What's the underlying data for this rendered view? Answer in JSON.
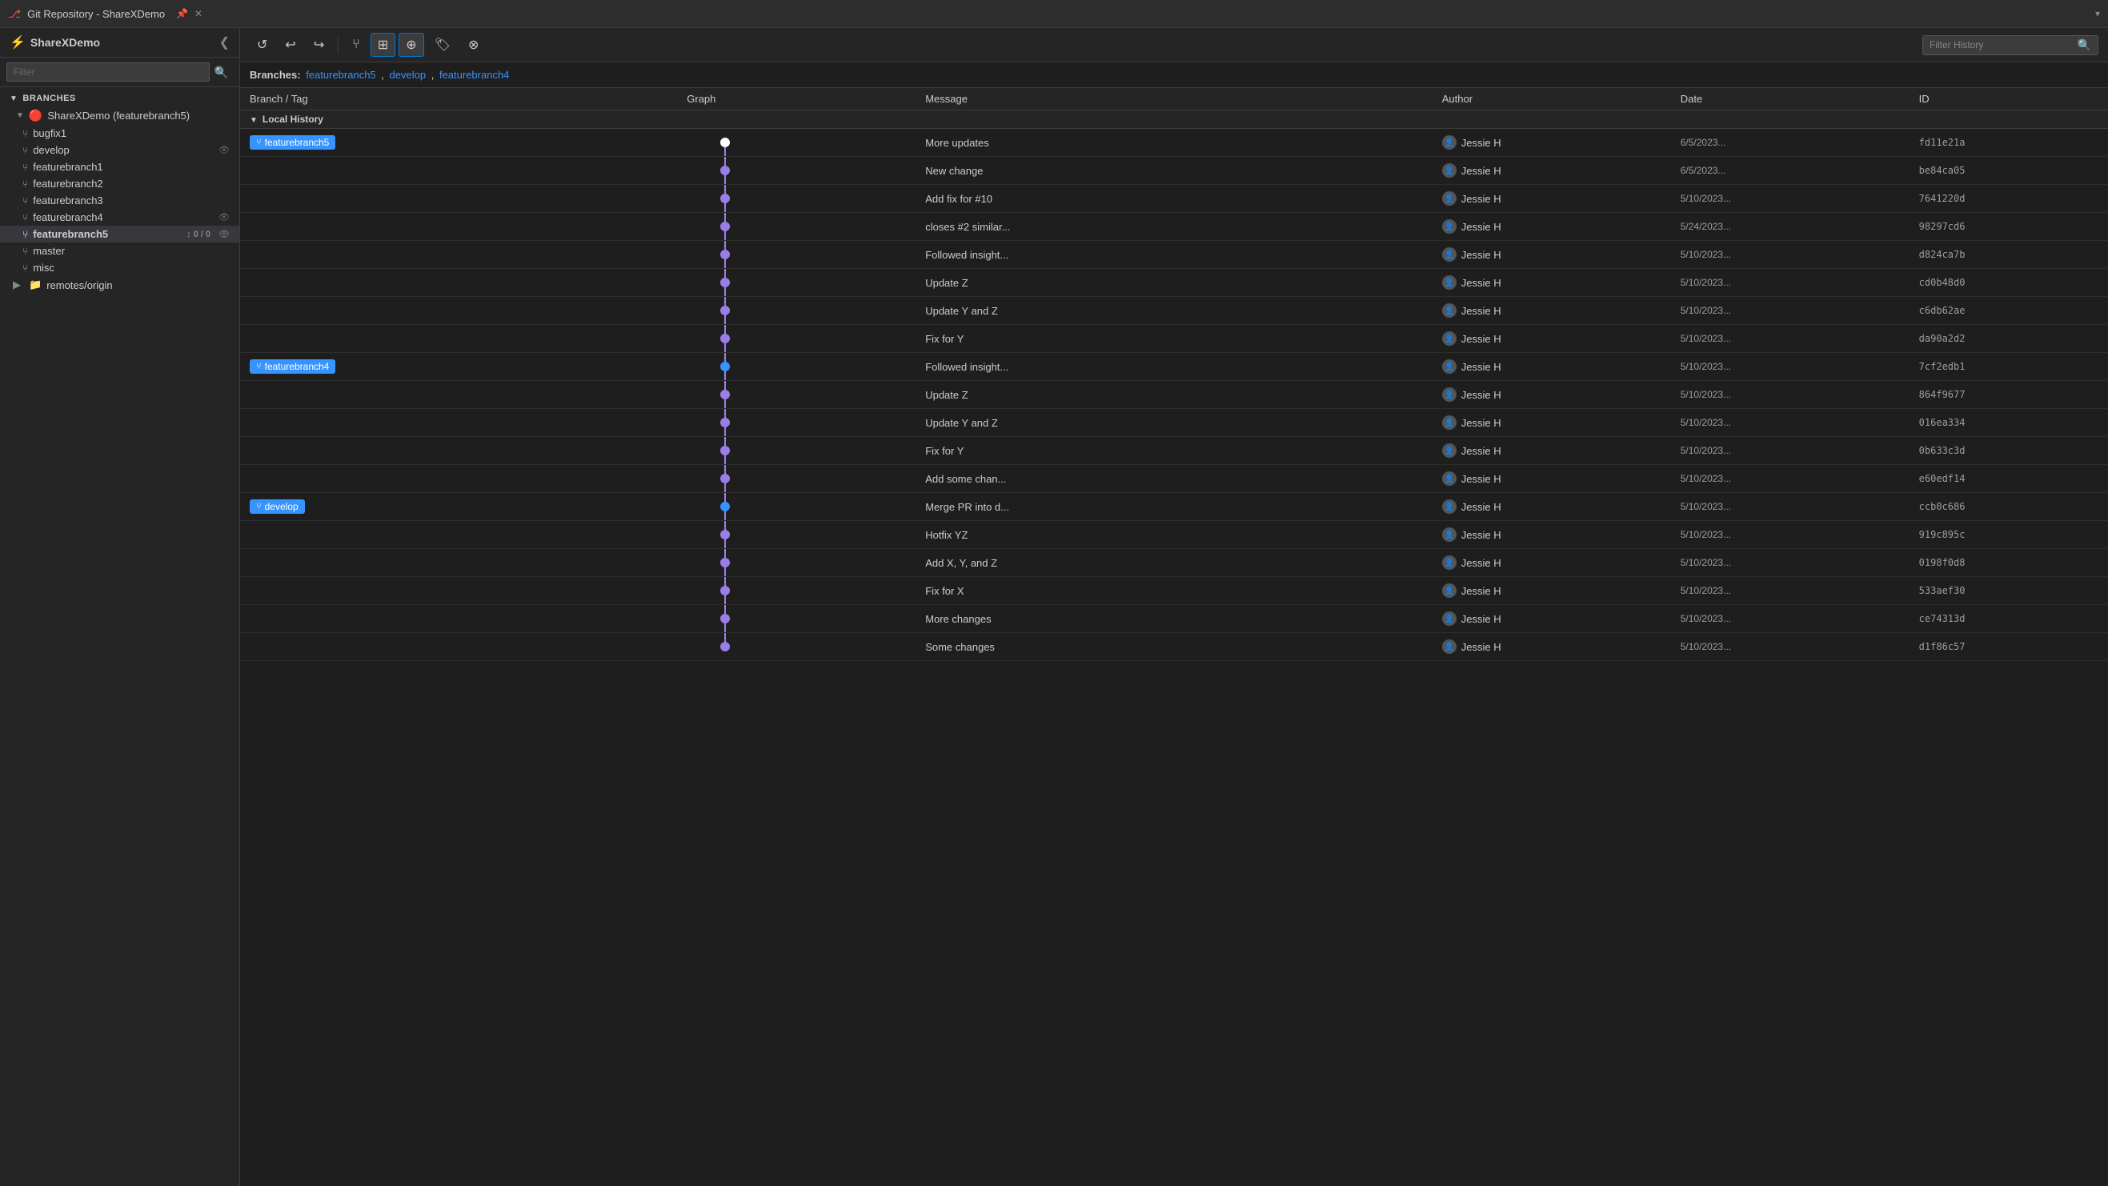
{
  "titleBar": {
    "title": "Git Repository - ShareXDemo",
    "pinLabel": "📌",
    "closeLabel": "✕"
  },
  "sidebar": {
    "repoName": "ShareXDemo",
    "filterPlaceholder": "Filter",
    "branchesSectionLabel": "Branches",
    "items": [
      {
        "id": "sharexdemo",
        "label": "ShareXDemo (featurebranch5)",
        "indent": 0,
        "isRoot": true,
        "active": false
      },
      {
        "id": "bugfix1",
        "label": "bugfix1",
        "indent": 1
      },
      {
        "id": "develop",
        "label": "develop",
        "indent": 1,
        "hasEye": true
      },
      {
        "id": "featurebranch1",
        "label": "featurebranch1",
        "indent": 1
      },
      {
        "id": "featurebranch2",
        "label": "featurebranch2",
        "indent": 1
      },
      {
        "id": "featurebranch3",
        "label": "featurebranch3",
        "indent": 1
      },
      {
        "id": "featurebranch4",
        "label": "featurebranch4",
        "indent": 1,
        "hasEye": true
      },
      {
        "id": "featurebranch5",
        "label": "featurebranch5",
        "indent": 1,
        "active": true,
        "syncBadge": "↕ 0 / 0",
        "hasEye": true
      },
      {
        "id": "master",
        "label": "master",
        "indent": 1
      },
      {
        "id": "misc",
        "label": "misc",
        "indent": 1
      },
      {
        "id": "remotes",
        "label": "remotes/origin",
        "indent": 0,
        "isRemote": true
      }
    ]
  },
  "toolbar": {
    "refreshLabel": "↺",
    "undoLabel": "↩",
    "redoLabel": "↪",
    "branchLabel": "⎇",
    "commitGraphLabel": "⦿",
    "commitAllLabel": "⊕",
    "tagLabel": "🏷",
    "moreLabel": "⊗",
    "filterHistoryPlaceholder": "Filter History",
    "searchIcon": "🔍"
  },
  "branchesBar": {
    "label": "Branches:",
    "branches": [
      "featurebranch5",
      "develop",
      "featurebranch4"
    ]
  },
  "historyTable": {
    "headers": {
      "branchTag": "Branch / Tag",
      "graph": "Graph",
      "message": "Message",
      "author": "Author",
      "date": "Date",
      "id": "ID"
    },
    "sections": [
      {
        "sectionLabel": "Local History",
        "commits": [
          {
            "branchTag": "featurebranch5",
            "message": "More updates",
            "author": "Jessie H",
            "date": "6/5/2023...",
            "id": "fd11e21a",
            "graphType": "head",
            "color": "#9b7de8"
          },
          {
            "branchTag": "",
            "message": "New change",
            "author": "Jessie H",
            "date": "6/5/2023...",
            "id": "be84ca05",
            "graphType": "mid",
            "color": "#9b7de8"
          },
          {
            "branchTag": "",
            "message": "Add fix for #10",
            "author": "Jessie H",
            "date": "5/10/2023...",
            "id": "7641220d",
            "graphType": "mid",
            "color": "#9b7de8"
          },
          {
            "branchTag": "",
            "message": "closes #2 similar...",
            "author": "Jessie H",
            "date": "5/24/2023...",
            "id": "98297cd6",
            "graphType": "mid",
            "color": "#9b7de8"
          },
          {
            "branchTag": "",
            "message": "Followed insight...",
            "author": "Jessie H",
            "date": "5/10/2023...",
            "id": "d824ca7b",
            "graphType": "mid",
            "color": "#9b7de8"
          },
          {
            "branchTag": "",
            "message": "Update Z",
            "author": "Jessie H",
            "date": "5/10/2023...",
            "id": "cd0b48d0",
            "graphType": "mid",
            "color": "#9b7de8"
          },
          {
            "branchTag": "",
            "message": "Update Y and Z",
            "author": "Jessie H",
            "date": "5/10/2023...",
            "id": "c6db62ae",
            "graphType": "mid",
            "color": "#9b7de8"
          },
          {
            "branchTag": "",
            "message": "Fix for Y",
            "author": "Jessie H",
            "date": "5/10/2023...",
            "id": "da90a2d2",
            "graphType": "mid",
            "color": "#9b7de8"
          },
          {
            "branchTag": "featurebranch4",
            "message": "Followed insight...",
            "author": "Jessie H",
            "date": "5/10/2023...",
            "id": "7cf2edb1",
            "graphType": "branch-head",
            "color": "#3794ff"
          },
          {
            "branchTag": "",
            "message": "Update Z",
            "author": "Jessie H",
            "date": "5/10/2023...",
            "id": "864f9677",
            "graphType": "mid",
            "color": "#9b7de8"
          },
          {
            "branchTag": "",
            "message": "Update Y and Z",
            "author": "Jessie H",
            "date": "5/10/2023...",
            "id": "016ea334",
            "graphType": "mid",
            "color": "#9b7de8"
          },
          {
            "branchTag": "",
            "message": "Fix for Y",
            "author": "Jessie H",
            "date": "5/10/2023...",
            "id": "0b633c3d",
            "graphType": "mid",
            "color": "#9b7de8"
          },
          {
            "branchTag": "",
            "message": "Add some chan...",
            "author": "Jessie H",
            "date": "5/10/2023...",
            "id": "e60edf14",
            "graphType": "mid",
            "color": "#9b7de8"
          },
          {
            "branchTag": "develop",
            "message": "Merge PR into d...",
            "author": "Jessie H",
            "date": "5/10/2023...",
            "id": "ccb0c686",
            "graphType": "branch-head2",
            "color": "#3794ff"
          },
          {
            "branchTag": "",
            "message": "Hotfix YZ",
            "author": "Jessie H",
            "date": "5/10/2023...",
            "id": "919c895c",
            "graphType": "mid",
            "color": "#9b7de8"
          },
          {
            "branchTag": "",
            "message": "Add X, Y, and Z",
            "author": "Jessie H",
            "date": "5/10/2023...",
            "id": "0198f0d8",
            "graphType": "mid",
            "color": "#9b7de8"
          },
          {
            "branchTag": "",
            "message": "Fix for X",
            "author": "Jessie H",
            "date": "5/10/2023...",
            "id": "533aef30",
            "graphType": "mid",
            "color": "#9b7de8"
          },
          {
            "branchTag": "",
            "message": "More changes",
            "author": "Jessie H",
            "date": "5/10/2023...",
            "id": "ce74313d",
            "graphType": "mid",
            "color": "#9b7de8"
          },
          {
            "branchTag": "",
            "message": "Some changes",
            "author": "Jessie H",
            "date": "5/10/2023...",
            "id": "d1f86c57",
            "graphType": "mid-bottom",
            "color": "#9b7de8"
          }
        ]
      }
    ]
  }
}
